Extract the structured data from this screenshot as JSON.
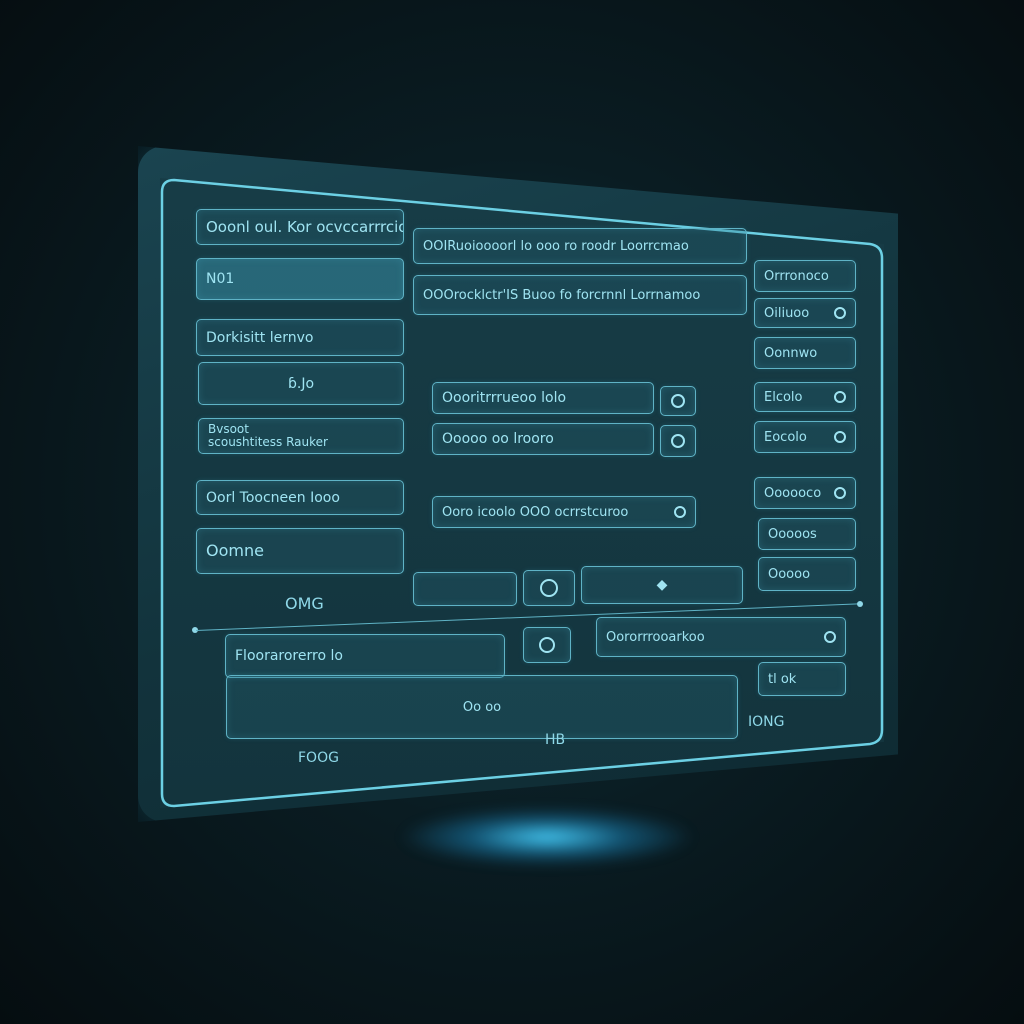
{
  "colors": {
    "accent": "#5fb3c6",
    "text": "#9fe4f2",
    "panel": "#173c46",
    "background": "#050d10"
  },
  "left_column": {
    "header_field": "Ooonl oul. Kor ocvccarrrcio",
    "item_highlight": "N01",
    "item_2": "Dorkisitt lernvo",
    "item_3_center": "ɓ.Jo",
    "item_4_line1": "Bvsoot",
    "item_4_line2": "scoushtitess Rauker",
    "item_5": "Oorl Toocneen Iooo",
    "item_6": "Oomne",
    "footer_label": "OMG"
  },
  "middle_column": {
    "top_field_1": "OOIRuoioooorl lo ooo ro roodr Loorrcmao",
    "top_field_2": "OOOrocklctr'IS Buoo fo forcrnnl Lorrnamoo",
    "field_a": "Oooritrrrueoo lolo",
    "field_b": "Ooooo oo lrooro",
    "field_c": "Ooro icoolo OOO ocrrstcuroo",
    "icon_a": "circle-icon",
    "icon_b": "record-icon",
    "icon_c": "ring-icon"
  },
  "right_column": {
    "item_1": "Orrronoco",
    "item_2": "Oiliuoo",
    "item_3": "Oonnwo",
    "item_4": "Elcolo",
    "item_5": "Eocolo",
    "item_6": "Oooooco",
    "item_7": "Ooooos",
    "item_8": "Ooooo"
  },
  "bottom_section": {
    "field_left": "Floorarorerro lo",
    "field_right": "Oororrrooarkoo",
    "field_wide": "Oo oo",
    "small_field": "tl ok",
    "label_left": "FOOG",
    "label_middle": "HB",
    "label_right": "IONG"
  }
}
